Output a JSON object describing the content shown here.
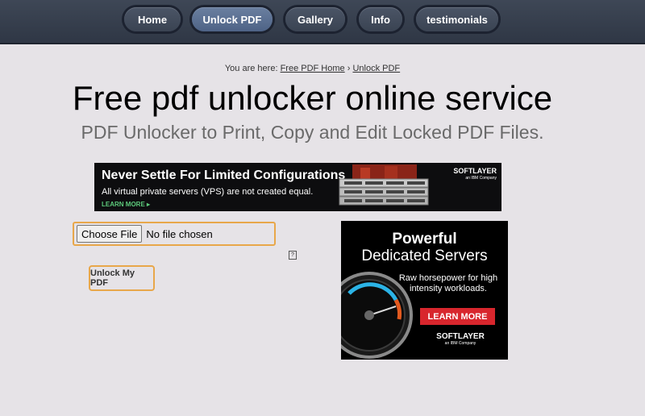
{
  "nav": {
    "items": [
      {
        "label": "Home"
      },
      {
        "label": "Unlock PDF",
        "active": true
      },
      {
        "label": "Gallery"
      },
      {
        "label": "Info"
      },
      {
        "label": "testimonials"
      }
    ]
  },
  "breadcrumb": {
    "prefix": "You are here:",
    "home_link": "Free PDF Home",
    "separator": "›",
    "current_link": "Unlock PDF"
  },
  "page": {
    "title": "Free pdf unlocker online service",
    "subtitle": "PDF Unlocker to Print, Copy and Edit Locked PDF Files."
  },
  "banner_ad": {
    "headline": "Never Settle For Limited Configurations",
    "subline": "All virtual private servers (VPS) are not created equal.",
    "cta": "LEARN MORE ▸",
    "brand": "SOFTLAYER",
    "brand_sub": "an IBM Company"
  },
  "form": {
    "choose_file_label": "Choose File",
    "no_file_text": "No file chosen",
    "unlock_button": "Unlock My PDF"
  },
  "side_ad": {
    "line1": "Powerful",
    "line2": "Dedicated Servers",
    "description": "Raw horsepower for high intensity workloads.",
    "cta": "LEARN MORE",
    "brand": "SOFTLAYER",
    "brand_sub": "an IBM Company"
  },
  "colors": {
    "accent_border": "#e8a74a",
    "nav_background": "#2f3745",
    "ad_red": "#d8262d"
  }
}
